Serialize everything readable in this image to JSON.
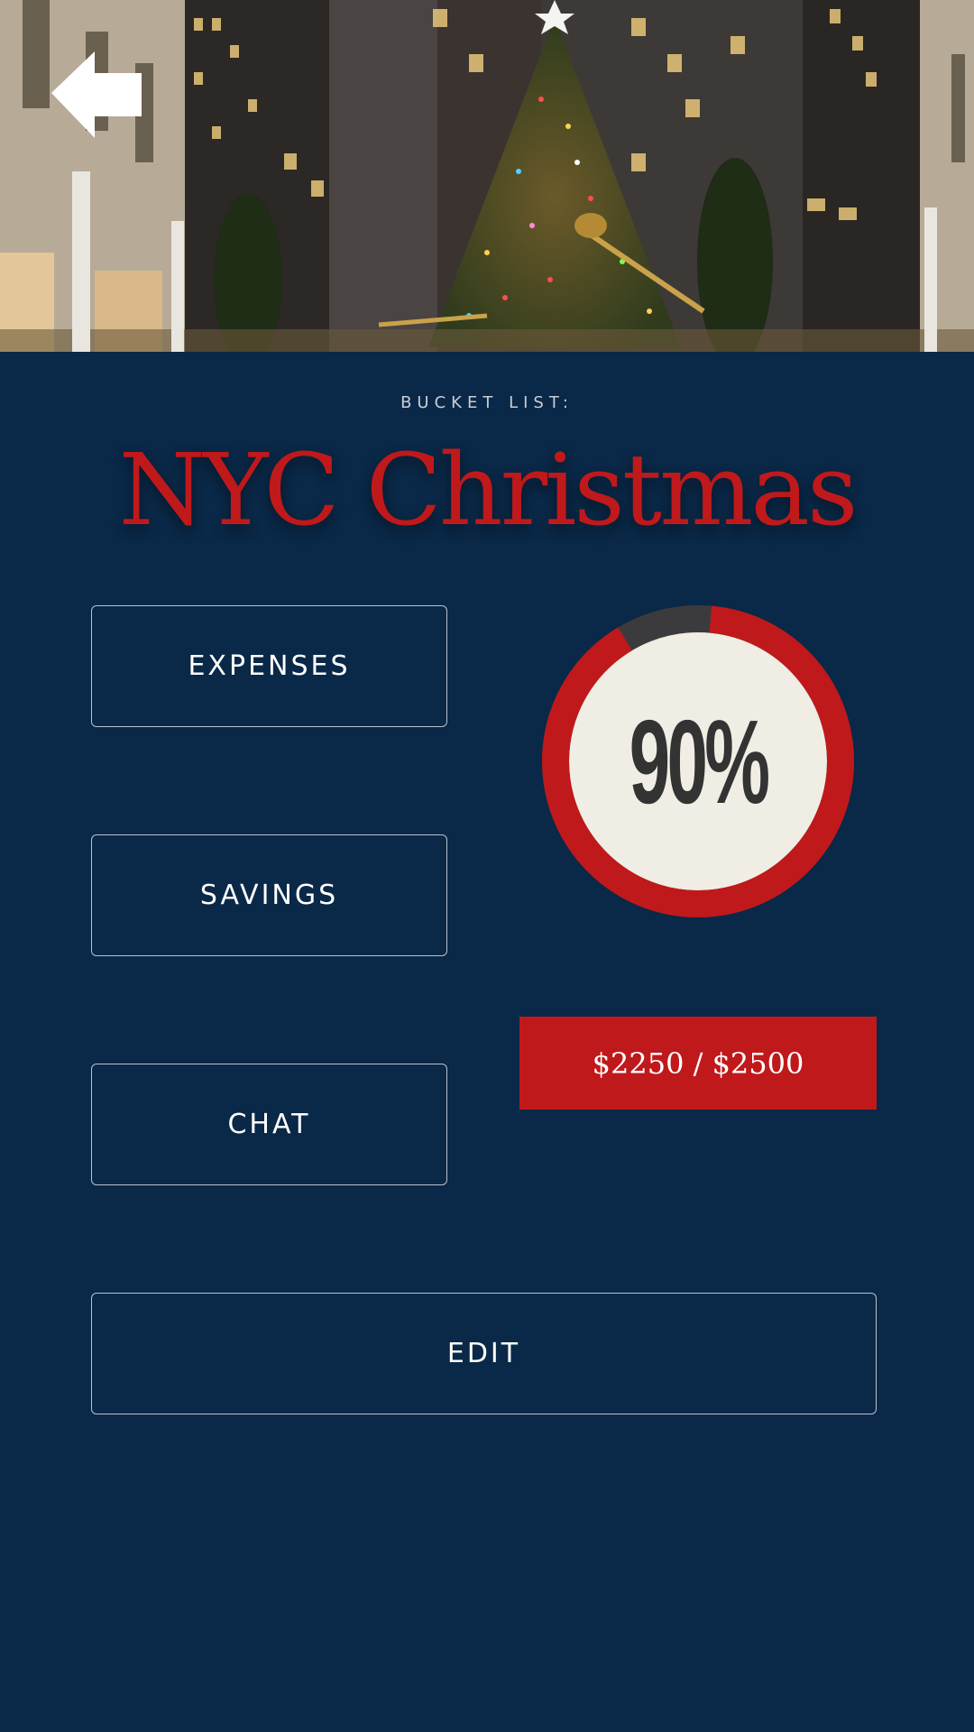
{
  "hero": {
    "image": "Christmas tree photo"
  },
  "header": {
    "back_icon": "arrow-left-icon"
  },
  "bucket": {
    "eyebrow": "BUCKET LIST:",
    "title": "NYC Christmas"
  },
  "actions": {
    "expenses_label": "EXPENSES",
    "savings_label": "SAVINGS",
    "chat_label": "CHAT",
    "edit_label": "EDIT"
  },
  "progress": {
    "percent": 90,
    "label": "90%"
  },
  "amount": {
    "label": "$2250 / $2500"
  },
  "colors": {
    "background": "#0a2847",
    "accent": "#c0191b",
    "ring_track": "#3b3b3e",
    "ring_center": "#f0ede4",
    "button_border": "#b8c2cf"
  }
}
